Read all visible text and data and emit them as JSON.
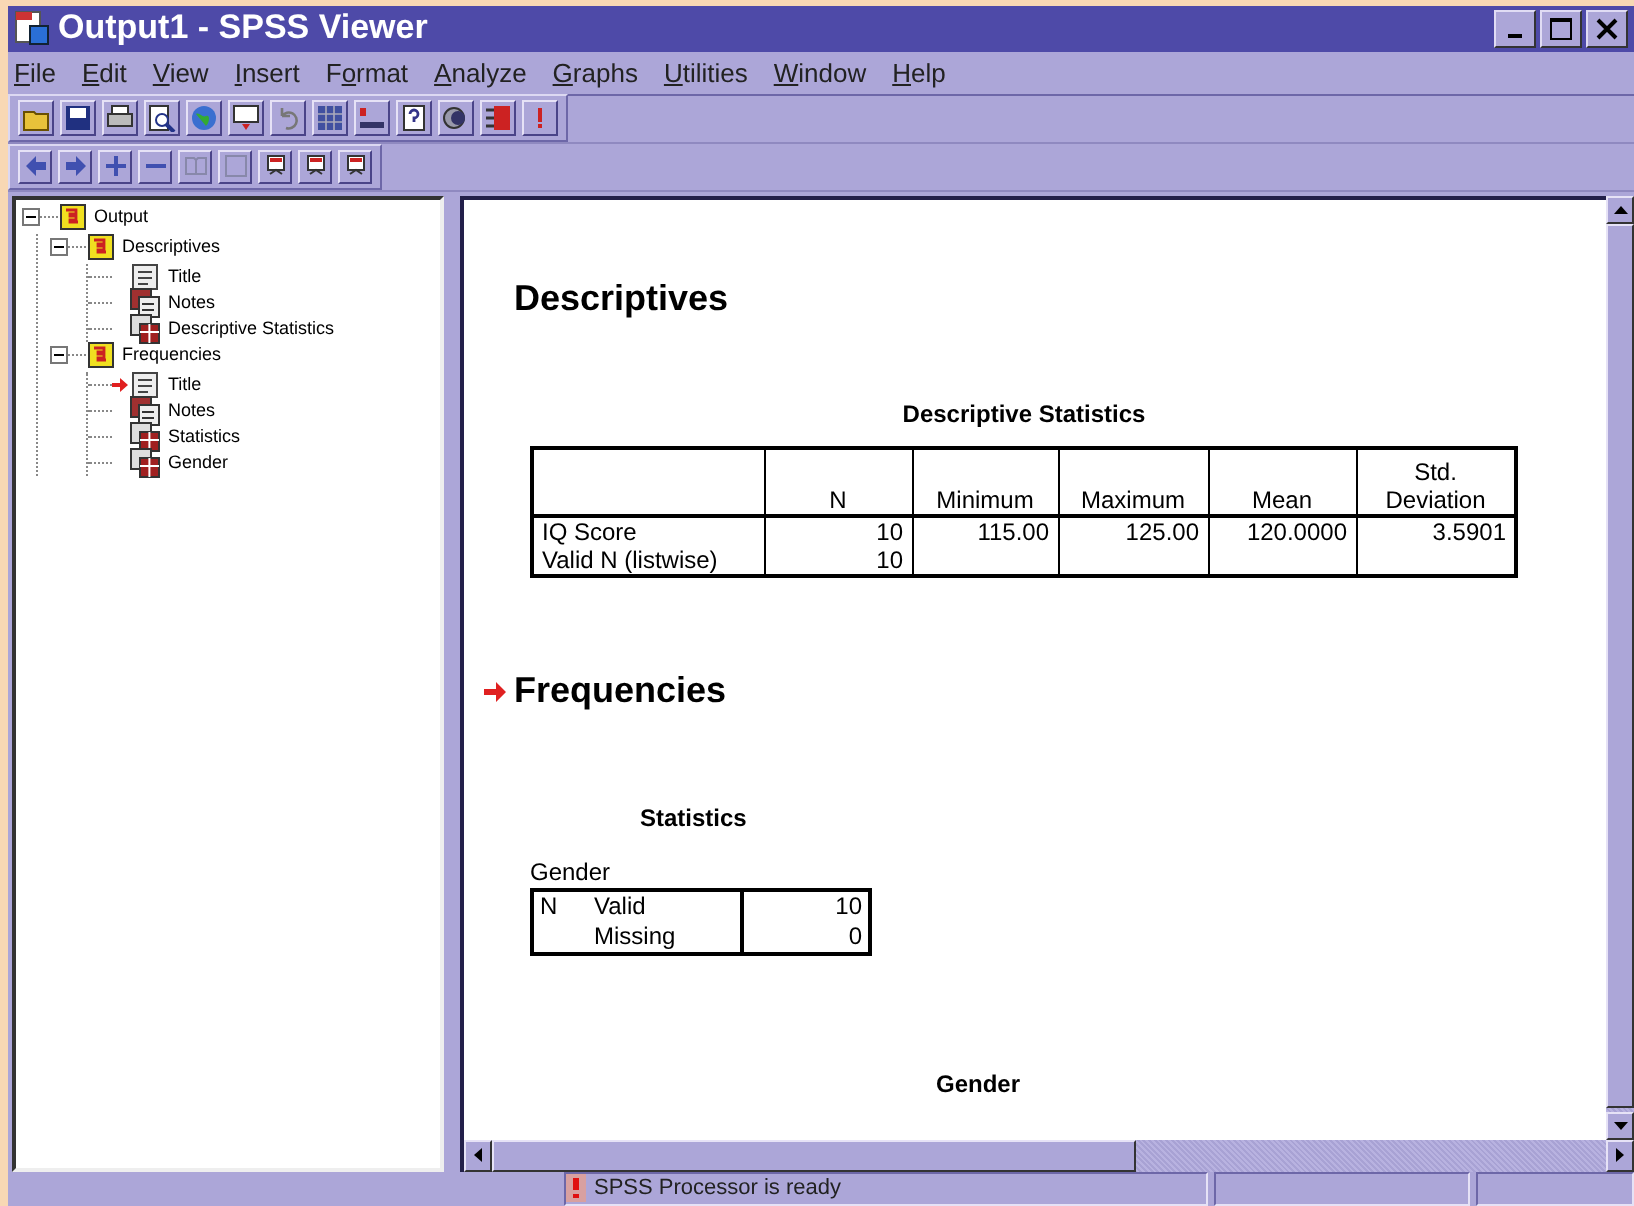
{
  "window": {
    "title": "Output1 - SPSS Viewer"
  },
  "menu": [
    {
      "key": "F",
      "post": "ile"
    },
    {
      "key": "E",
      "post": "dit"
    },
    {
      "key": "V",
      "post": "iew"
    },
    {
      "key": "I",
      "post": "nsert"
    },
    {
      "pre": "F",
      "key": "o",
      "post": "rmat"
    },
    {
      "key": "A",
      "post": "nalyze"
    },
    {
      "key": "G",
      "post": "raphs"
    },
    {
      "key": "U",
      "post": "tilities"
    },
    {
      "key": "W",
      "post": "indow"
    },
    {
      "key": "H",
      "post": "elp"
    }
  ],
  "outline": [
    {
      "label": "Output",
      "kind": "folder",
      "expanded": true,
      "children": [
        {
          "label": "Descriptives",
          "kind": "folder",
          "expanded": true,
          "children": [
            {
              "label": "Title",
              "kind": "title",
              "current": false
            },
            {
              "label": "Notes",
              "kind": "notes",
              "current": false
            },
            {
              "label": "Descriptive Statistics",
              "kind": "table",
              "current": false
            }
          ]
        },
        {
          "label": "Frequencies",
          "kind": "folder",
          "expanded": true,
          "children": [
            {
              "label": "Title",
              "kind": "title",
              "current": true
            },
            {
              "label": "Notes",
              "kind": "notes",
              "current": false
            },
            {
              "label": "Statistics",
              "kind": "table",
              "current": false
            },
            {
              "label": "Gender",
              "kind": "table",
              "current": false
            }
          ]
        }
      ]
    }
  ],
  "output": {
    "blocks": [
      {
        "kind": "heading",
        "text": "Descriptives",
        "current": false
      },
      {
        "kind": "desc-table",
        "title": "Descriptive Statistics",
        "columns": [
          "N",
          "Minimum",
          "Maximum",
          "Mean",
          "Std. Deviation"
        ],
        "rows": [
          {
            "label": "IQ Score",
            "cells": [
              "10",
              "115.00",
              "125.00",
              "120.0000",
              "3.5901"
            ]
          },
          {
            "label": "Valid N (listwise)",
            "cells": [
              "10"
            ]
          }
        ]
      },
      {
        "kind": "heading",
        "text": "Frequencies",
        "current": true
      },
      {
        "kind": "stats-table",
        "title": "Statistics",
        "variable": "Gender",
        "group": "N",
        "rows": [
          {
            "label": "Valid",
            "value": "10"
          },
          {
            "label": "Missing",
            "value": "0"
          }
        ]
      },
      {
        "kind": "table-title",
        "title": "Gender"
      }
    ]
  },
  "status_bar": {
    "text": "SPSS Processor  is ready"
  }
}
